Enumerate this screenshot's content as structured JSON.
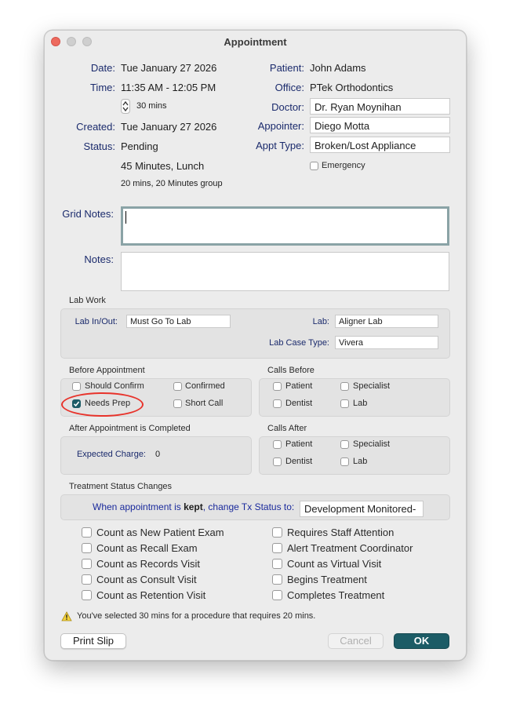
{
  "window": {
    "title": "Appointment"
  },
  "left": {
    "date_label": "Date:",
    "date": "Tue January 27 2026",
    "time_label": "Time:",
    "time": "11:35 AM - 12:05 PM",
    "duration": "30 mins",
    "created_label": "Created:",
    "created": "Tue January 27 2026",
    "status_label": "Status:",
    "status": "Pending",
    "procedure": "45 Minutes, Lunch",
    "procedure_detail": "20 mins, 20 Minutes group"
  },
  "right": {
    "patient_label": "Patient:",
    "patient": "John Adams",
    "office_label": "Office:",
    "office": "PTek Orthodontics",
    "doctor_label": "Doctor:",
    "doctor": "Dr. Ryan Moynihan",
    "appointer_label": "Appointer:",
    "appointer": "Diego Motta",
    "appt_type_label": "Appt Type:",
    "appt_type": "Broken/Lost Appliance",
    "emergency_label": "Emergency"
  },
  "notes": {
    "grid_label": "Grid Notes:",
    "grid_value": "",
    "notes_label": "Notes:",
    "notes_value": ""
  },
  "lab": {
    "title": "Lab Work",
    "in_out_label": "Lab In/Out:",
    "in_out": "Must Go To Lab",
    "lab_label": "Lab:",
    "lab": "Aligner Lab",
    "case_type_label": "Lab Case Type:",
    "case_type": "Vivera"
  },
  "before": {
    "title": "Before Appointment",
    "items": [
      {
        "label": "Should Confirm",
        "checked": false
      },
      {
        "label": "Confirmed",
        "checked": false
      },
      {
        "label": "Needs Prep",
        "checked": true
      },
      {
        "label": "Short Call",
        "checked": false
      }
    ]
  },
  "calls_before": {
    "title": "Calls Before",
    "items": [
      {
        "label": "Patient",
        "checked": false
      },
      {
        "label": "Specialist",
        "checked": false
      },
      {
        "label": "Dentist",
        "checked": false
      },
      {
        "label": "Lab",
        "checked": false
      }
    ]
  },
  "after": {
    "title": "After Appointment is Completed",
    "expected_label": "Expected Charge:",
    "expected": "0"
  },
  "calls_after": {
    "title": "Calls After",
    "items": [
      {
        "label": "Patient",
        "checked": false
      },
      {
        "label": "Specialist",
        "checked": false
      },
      {
        "label": "Dentist",
        "checked": false
      },
      {
        "label": "Lab",
        "checked": false
      }
    ]
  },
  "treatment": {
    "title": "Treatment Status Changes",
    "kept_pre": "When appointment is ",
    "kept_bold": "kept",
    "kept_post": ", change Tx Status to:",
    "tx_status": "Development Monitored-"
  },
  "counts_left": [
    "Count as New Patient Exam",
    "Count as Recall Exam",
    "Count as Records Visit",
    "Count as Consult Visit",
    "Count as Retention Visit"
  ],
  "counts_right": [
    "Requires Staff Attention",
    "Alert Treatment Coordinator",
    "Count as Virtual Visit",
    "Begins Treatment",
    "Completes Treatment"
  ],
  "warning": "You've selected 30 mins for a procedure that requires 20 mins.",
  "buttons": {
    "print": "Print Slip",
    "cancel": "Cancel",
    "ok": "OK"
  },
  "colors": {
    "accent": "#1c5c66",
    "label": "#1a2a6c",
    "annotation": "#e8332b",
    "close": "#ed6a5e"
  },
  "icons": {
    "stepper": "stepper-icon",
    "warning": "warning-icon",
    "check": "checkmark-icon"
  }
}
